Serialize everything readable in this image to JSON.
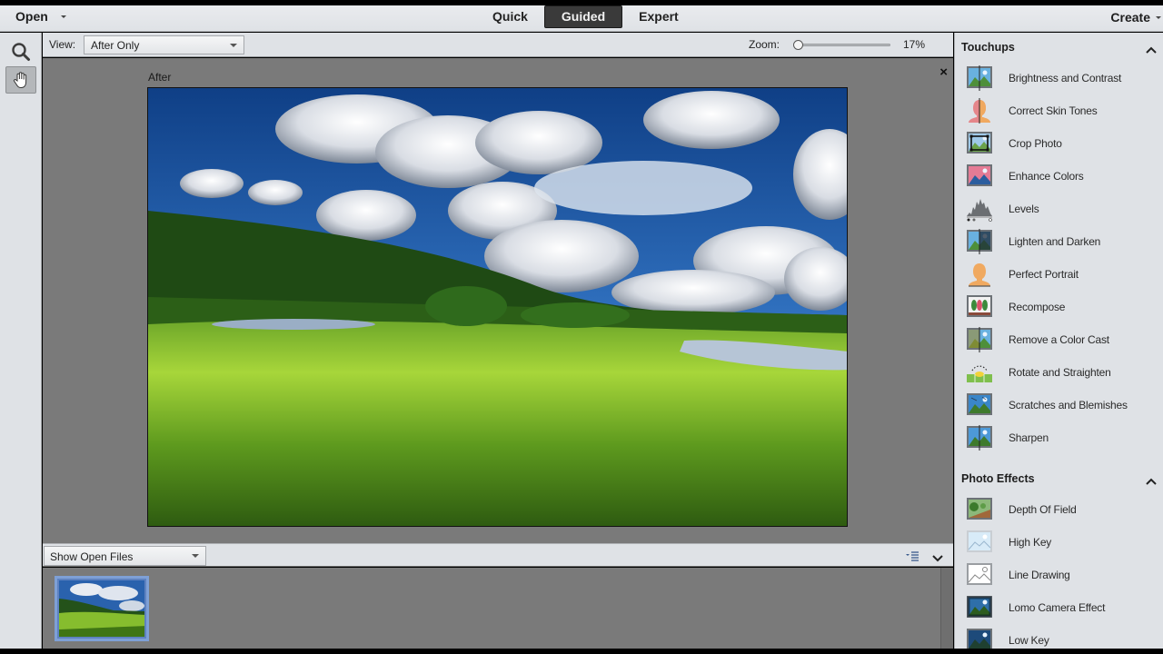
{
  "menubar": {
    "open_label": "Open",
    "modes": [
      {
        "label": "Quick",
        "active": false
      },
      {
        "label": "Guided",
        "active": true
      },
      {
        "label": "Expert",
        "active": false
      }
    ],
    "create_label": "Create"
  },
  "tools": [
    {
      "name": "zoom-tool",
      "icon": "magnifier-icon",
      "selected": false
    },
    {
      "name": "hand-tool",
      "icon": "hand-icon",
      "selected": true
    }
  ],
  "viewbar": {
    "view_label": "View:",
    "view_value": "After Only",
    "zoom_label": "Zoom:",
    "zoom_value": "17%",
    "zoom_percent": 17
  },
  "canvas": {
    "after_label": "After",
    "close_label": "×",
    "photo_description": "Green meadow landscape with forested hill, pond, and dramatic cumulus clouds in blue sky"
  },
  "bin": {
    "show_label": "Show Open Files",
    "thumbnails": [
      {
        "selected": true
      }
    ]
  },
  "panel": {
    "sections": [
      {
        "title": "Touchups",
        "expanded": true,
        "items": [
          {
            "label": "Brightness and Contrast",
            "icon": "brightness-contrast-icon"
          },
          {
            "label": "Correct Skin Tones",
            "icon": "skin-tones-icon"
          },
          {
            "label": "Crop Photo",
            "icon": "crop-photo-icon"
          },
          {
            "label": "Enhance Colors",
            "icon": "enhance-colors-icon"
          },
          {
            "label": "Levels",
            "icon": "levels-icon"
          },
          {
            "label": "Lighten and Darken",
            "icon": "lighten-darken-icon"
          },
          {
            "label": "Perfect Portrait",
            "icon": "perfect-portrait-icon"
          },
          {
            "label": "Recompose",
            "icon": "recompose-icon"
          },
          {
            "label": "Remove a Color Cast",
            "icon": "color-cast-icon"
          },
          {
            "label": "Rotate and Straighten",
            "icon": "rotate-straighten-icon"
          },
          {
            "label": "Scratches and Blemishes",
            "icon": "scratches-icon"
          },
          {
            "label": "Sharpen",
            "icon": "sharpen-icon"
          }
        ]
      },
      {
        "title": "Photo Effects",
        "expanded": true,
        "items": [
          {
            "label": "Depth Of Field",
            "icon": "depth-of-field-icon"
          },
          {
            "label": "High Key",
            "icon": "high-key-icon"
          },
          {
            "label": "Line Drawing",
            "icon": "line-drawing-icon"
          },
          {
            "label": "Lomo Camera Effect",
            "icon": "lomo-icon"
          },
          {
            "label": "Low Key",
            "icon": "low-key-icon"
          }
        ]
      }
    ]
  },
  "colors": {
    "chrome": "#dfe2e6",
    "canvas": "#7a7a7a",
    "active_mode": "#3a3a3a",
    "thumb_selection": "#7ea0d6"
  }
}
